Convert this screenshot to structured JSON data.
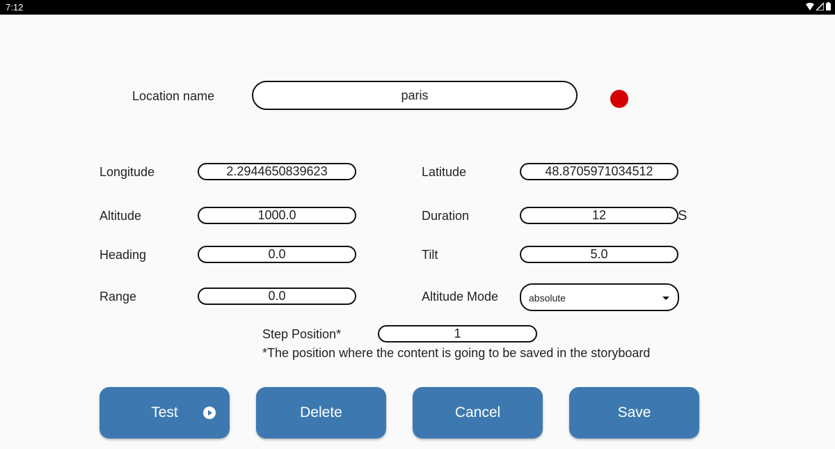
{
  "status": {
    "time": "7:12"
  },
  "form": {
    "location_label": "Location name",
    "location_value": "paris",
    "longitude_label": "Longitude",
    "longitude_value": "2.2944650839623",
    "latitude_label": "Latitude",
    "latitude_value": "48.8705971034512",
    "altitude_label": "Altitude",
    "altitude_value": "1000.0",
    "duration_label": "Duration",
    "duration_value": "12",
    "duration_unit": "S",
    "heading_label": "Heading",
    "heading_value": "0.0",
    "tilt_label": "Tilt",
    "tilt_value": "5.0",
    "range_label": "Range",
    "range_value": "0.0",
    "altitude_mode_label": "Altitude Mode",
    "altitude_mode_value": "absolute",
    "step_label": "Step Position*",
    "step_value": "1",
    "step_note": "*The position where the content is going to be saved in the storyboard"
  },
  "buttons": {
    "test": "Test",
    "delete": "Delete",
    "cancel": "Cancel",
    "save": "Save"
  },
  "colors": {
    "button": "#3d79b0",
    "status_dot": "#d50000"
  }
}
